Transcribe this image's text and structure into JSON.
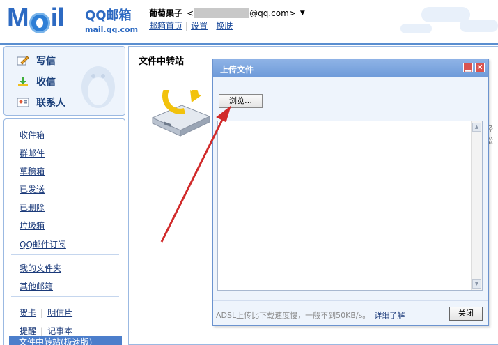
{
  "header": {
    "logo_main": "M",
    "logo_tail": "il",
    "logo_cn": "QQ邮箱",
    "logo_url": "mail.qq.com",
    "user_name": "葡萄果子",
    "email_prefix": "<",
    "email_suffix": "@qq.com>",
    "caret": "▼",
    "links": [
      "邮箱首页",
      "设置",
      "换肤"
    ],
    "link_sep": "|",
    "link_sep_dash": "-"
  },
  "sidebar": {
    "primary": [
      {
        "label": "写信",
        "icon": "pencil-icon"
      },
      {
        "label": "收信",
        "icon": "inbox-download-icon"
      },
      {
        "label": "联系人",
        "icon": "contacts-card-icon"
      }
    ],
    "folders": [
      "收件箱",
      "群邮件",
      "草稿箱",
      "已发送",
      "已删除",
      "垃圾箱",
      "QQ邮件订阅"
    ],
    "extra": [
      "我的文件夹",
      "其他邮箱"
    ],
    "tools_row1": [
      "贺卡",
      "明信片"
    ],
    "tools_row2": [
      "提醒",
      "记事本"
    ],
    "active_item": "文件中转站(极速版)"
  },
  "main": {
    "title": "文件中转站",
    "cut_text": "经松"
  },
  "dialog": {
    "title": "上传文件",
    "browse_label": "浏览…",
    "footer_note": "ADSL上传比下载速度慢，一般不到50KB/s。",
    "footer_link": "详细了解",
    "close_label": "关闭"
  },
  "colors": {
    "brand": "#2d6ac2",
    "accent_red": "#d12b2b",
    "panel_bg": "#eef4fc"
  }
}
